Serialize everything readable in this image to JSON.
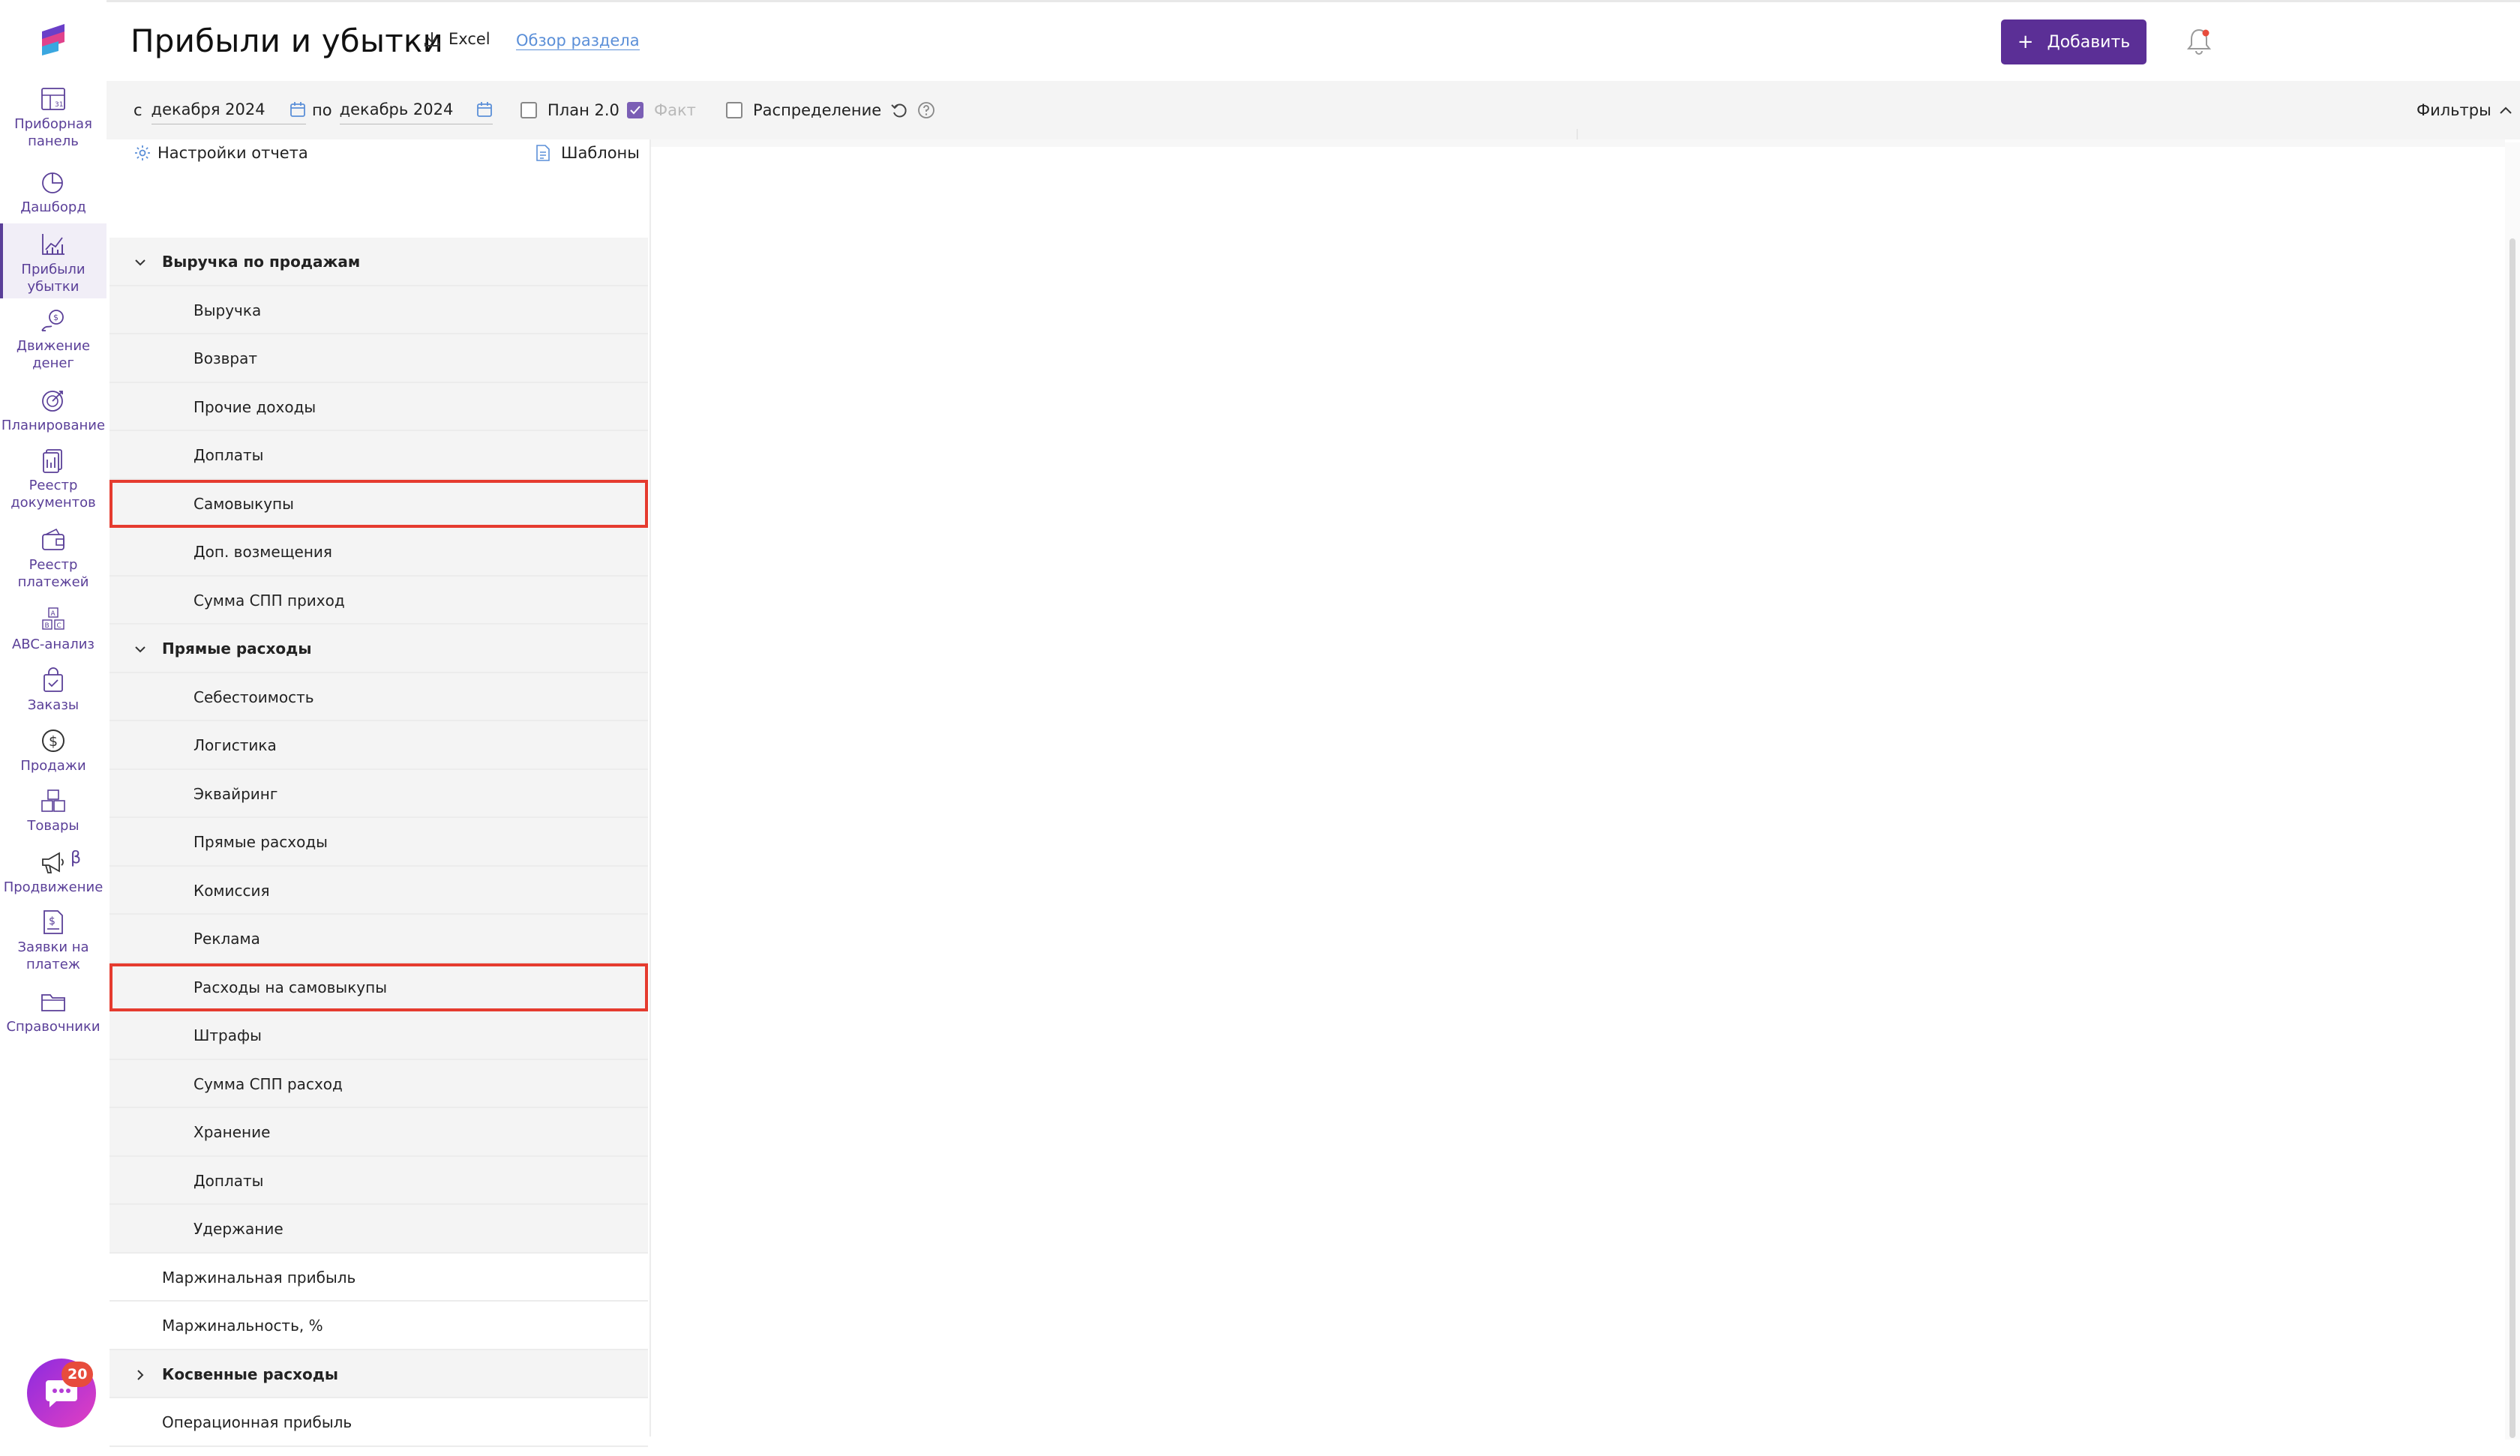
{
  "header": {
    "title": "Прибыли и убытки",
    "excel_label": "Excel",
    "overview_link": "Обзор раздела",
    "add_button": "Добавить"
  },
  "sidebar": {
    "items": [
      {
        "label": "Приборная\nпанель",
        "icon": "dashboard-panel-icon"
      },
      {
        "label": "Дашборд",
        "icon": "pie-chart-icon"
      },
      {
        "label": "Прибыли\nубытки",
        "icon": "bar-chart-icon",
        "active": true
      },
      {
        "label": "Движение\nденег",
        "icon": "money-flow-icon"
      },
      {
        "label": "Планирование",
        "icon": "target-icon"
      },
      {
        "label": "Реестр\nдокументов",
        "icon": "documents-icon"
      },
      {
        "label": "Реестр\nплатежей",
        "icon": "wallet-icon"
      },
      {
        "label": "ABC-анализ",
        "icon": "abc-icon"
      },
      {
        "label": "Заказы",
        "icon": "shopping-bag-icon"
      },
      {
        "label": "Продажи",
        "icon": "dollar-circle-icon"
      },
      {
        "label": "Товары",
        "icon": "boxes-icon"
      },
      {
        "label": "Продвижение",
        "icon": "megaphone-icon",
        "badge": "β"
      },
      {
        "label": "Заявки на\nплатеж",
        "icon": "payment-request-icon"
      },
      {
        "label": "Справочники",
        "icon": "folder-icon"
      }
    ],
    "chat_badge": "20"
  },
  "filters": {
    "from_prefix": "с",
    "from_value": "декабря 2024",
    "to_prefix": "по",
    "to_value": "декабрь 2024",
    "plan_label": "План 2.0",
    "fact_label": "Факт",
    "distribution_label": "Распределение",
    "filters_label": "Фильтры"
  },
  "panel": {
    "settings_label": "Настройки отчета",
    "templates_label": "Шаблоны",
    "rows": [
      {
        "label": "Выручка по продажам",
        "type": "group",
        "expanded": true
      },
      {
        "label": "Выручка",
        "type": "child"
      },
      {
        "label": "Возврат",
        "type": "child"
      },
      {
        "label": "Прочие доходы",
        "type": "child"
      },
      {
        "label": "Доплаты",
        "type": "child"
      },
      {
        "label": "Самовыкупы",
        "type": "child",
        "highlight": true
      },
      {
        "label": "Доп. возмещения",
        "type": "child"
      },
      {
        "label": "Сумма СПП приход",
        "type": "child"
      },
      {
        "label": "Прямые расходы",
        "type": "group",
        "expanded": true
      },
      {
        "label": "Себестоимость",
        "type": "child"
      },
      {
        "label": "Логистика",
        "type": "child"
      },
      {
        "label": "Эквайринг",
        "type": "child"
      },
      {
        "label": "Прямые расходы",
        "type": "child"
      },
      {
        "label": "Комиссия",
        "type": "child"
      },
      {
        "label": "Реклама",
        "type": "child"
      },
      {
        "label": "Расходы на самовыкупы",
        "type": "child",
        "highlight": true
      },
      {
        "label": "Штрафы",
        "type": "child"
      },
      {
        "label": "Сумма СПП расход",
        "type": "child"
      },
      {
        "label": "Хранение",
        "type": "child"
      },
      {
        "label": "Доплаты",
        "type": "child"
      },
      {
        "label": "Удержание",
        "type": "child"
      },
      {
        "label": "Маржинальная прибыль",
        "type": "plain"
      },
      {
        "label": "Маржинальность, %",
        "type": "plain"
      },
      {
        "label": "Косвенные расходы",
        "type": "group",
        "expanded": false
      },
      {
        "label": "Операционная прибыль",
        "type": "plain"
      }
    ]
  },
  "colors": {
    "brand": "#5b2f96",
    "nav_text": "#5a3f98",
    "highlight": "#e53b2f",
    "link": "#5b8fd8"
  }
}
